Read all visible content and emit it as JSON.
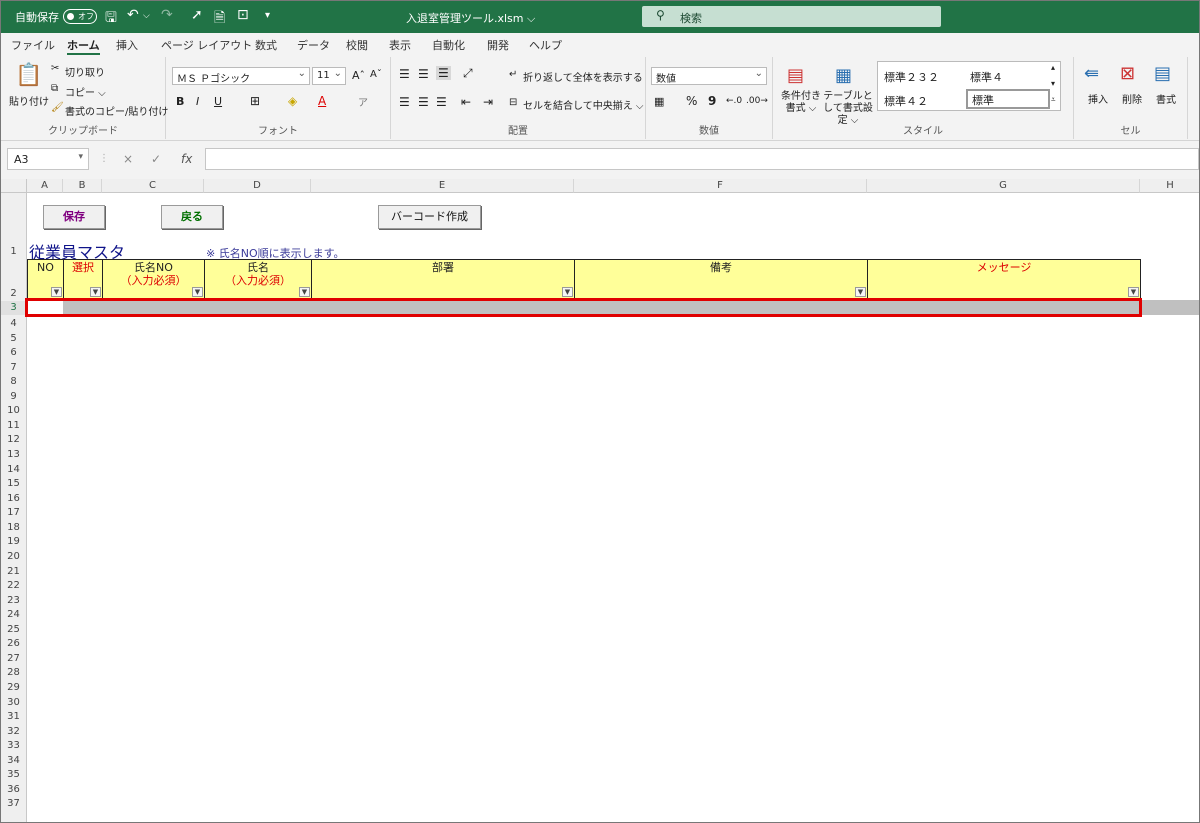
{
  "titlebar": {
    "autosave": "自動保存",
    "autosave_state": "オフ",
    "filename": "入退室管理ツール.xlsm ⌵",
    "search_placeholder": "検索"
  },
  "tabs": [
    "ファイル",
    "ホーム",
    "挿入",
    "ページ レイアウト",
    "数式",
    "データ",
    "校閲",
    "表示",
    "自動化",
    "開発",
    "ヘルプ"
  ],
  "ribbon": {
    "clipboard": {
      "label": "クリップボード",
      "paste": "貼り付け",
      "cut": "切り取り",
      "copy": "コピー ⌵",
      "format_painter": "書式のコピー/貼り付け"
    },
    "font": {
      "label": "フォント",
      "font_name": "ＭＳ Ｐゴシック",
      "font_size": "11",
      "grow": "A^",
      "shrink": "A˅",
      "bold": "B",
      "italic": "I",
      "underline": "U"
    },
    "alignment": {
      "label": "配置",
      "wrap": "折り返して全体を表示する",
      "merge": "セルを結合して中央揃え ⌵"
    },
    "number": {
      "label": "数値",
      "format": "数値",
      "percent": "%",
      "comma": "9"
    },
    "styles": {
      "label": "スタイル",
      "cond_format": "条件付き書式 ⌵",
      "table_format": "テーブルとして書式設定 ⌵",
      "s1": "標準２３２",
      "s2": "標準４",
      "s3": "標準４２",
      "s4": "標準"
    },
    "cells": {
      "label": "セル",
      "insert": "挿入",
      "delete": "削除",
      "format": "書式"
    }
  },
  "formula_bar": {
    "name_box": "A3",
    "cancel": "×",
    "enter": "✓",
    "fx": "fx",
    "value": ""
  },
  "columns": [
    "A",
    "B",
    "C",
    "D",
    "E",
    "F",
    "G",
    "H"
  ],
  "rows": [
    "1",
    "2",
    "3",
    "4",
    "5",
    "6",
    "7",
    "8",
    "9",
    "10",
    "11",
    "12",
    "13",
    "14",
    "15",
    "16",
    "17",
    "18",
    "19",
    "20",
    "21",
    "22",
    "23",
    "24",
    "25",
    "26",
    "27",
    "28",
    "29",
    "30",
    "31",
    "32",
    "33",
    "34",
    "35",
    "36",
    "37"
  ],
  "sheet": {
    "buttons": {
      "save": "保存",
      "back": "戻る",
      "barcode": "バーコード作成"
    },
    "title": "従業員マスタ",
    "note": "※ 氏名NO順に表示します。",
    "headers": {
      "no": "NO",
      "select": "選択",
      "name_no": "氏名NO",
      "name_no_sub": "（入力必須）",
      "name": "氏名",
      "name_sub": "（入力必須）",
      "dept": "部署",
      "remarks": "備考",
      "message": "メッセージ"
    }
  },
  "colors": {
    "accent": "#217346",
    "header_fill": "#ffff99",
    "highlight": "#e00000",
    "required": "#d00000"
  }
}
